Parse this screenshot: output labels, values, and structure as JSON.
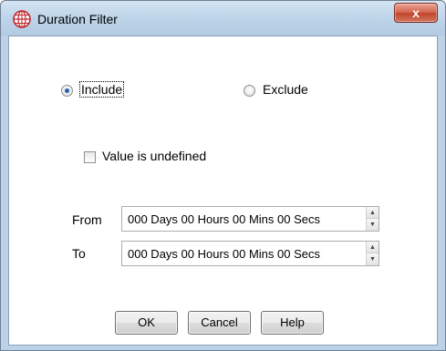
{
  "window": {
    "title": "Duration Filter",
    "close_glyph": "x",
    "title_icon": "network-globe-icon"
  },
  "mode": {
    "include_label": "Include",
    "exclude_label": "Exclude",
    "selected": "include"
  },
  "undefined_checkbox": {
    "label": "Value is undefined",
    "checked": false
  },
  "range": {
    "from_label": "From",
    "to_label": "To",
    "from_value": "000 Days 00 Hours 00 Mins 00 Secs",
    "to_value": "000 Days 00 Hours 00 Mins 00 Secs"
  },
  "buttons": {
    "ok": "OK",
    "cancel": "Cancel",
    "help": "Help"
  },
  "colors": {
    "titlebar": "#bcd3e8",
    "close_button": "#c04329",
    "radio_selected": "#2b5fb0"
  }
}
